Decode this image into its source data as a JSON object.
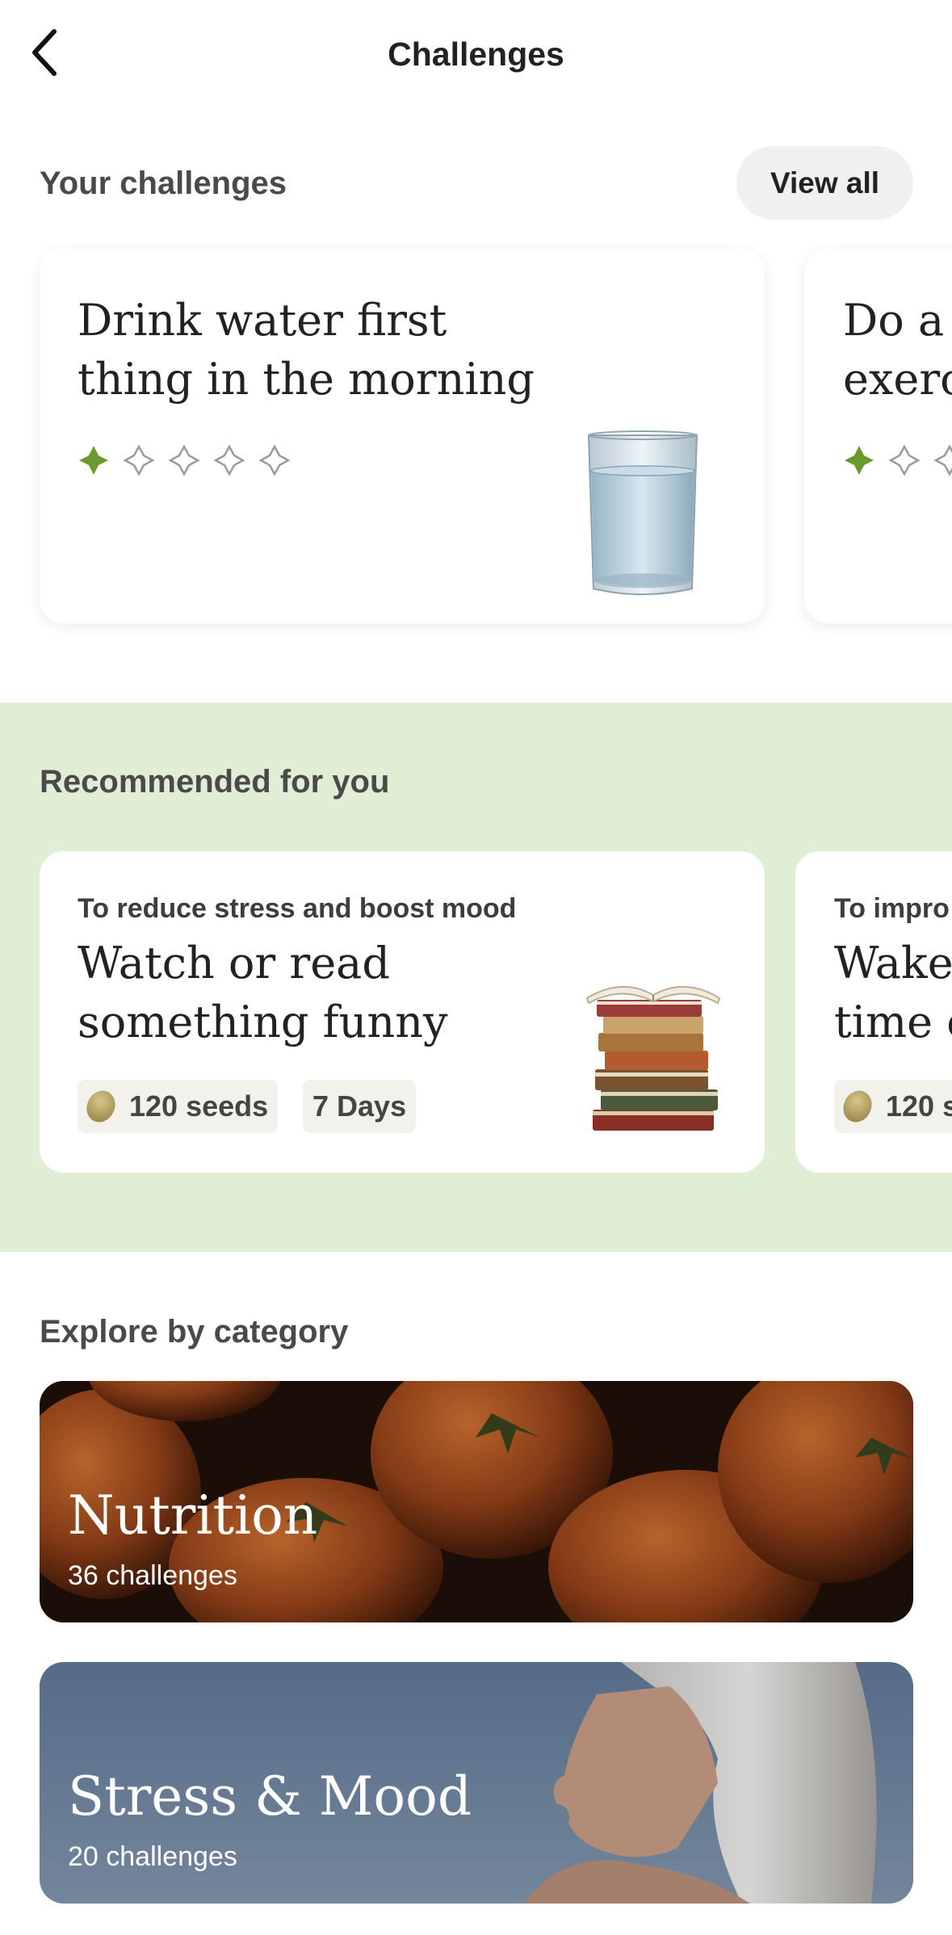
{
  "header": {
    "title": "Challenges"
  },
  "your_challenges": {
    "heading": "Your challenges",
    "view_all": "View all",
    "cards": [
      {
        "title_line1": "Drink water first",
        "title_line2": "thing in the morning",
        "progress_filled": 1,
        "progress_total": 5
      },
      {
        "title_line1": "Do a l",
        "title_line2": "exerc",
        "progress_filled": 1,
        "progress_total": 5
      }
    ]
  },
  "recommended": {
    "heading": "Recommended for you",
    "cards": [
      {
        "subtitle": "To reduce stress and boost mood",
        "title_line1": "Watch or read",
        "title_line2": "something funny",
        "seeds": "120 seeds",
        "duration": "7 Days"
      },
      {
        "subtitle": "To impro",
        "title_line1": "Wake",
        "title_line2": "time e",
        "seeds": "120 s"
      }
    ]
  },
  "categories": {
    "heading": "Explore by category",
    "items": [
      {
        "name": "Nutrition",
        "count": "36 challenges"
      },
      {
        "name": "Stress & Mood",
        "count": "20 challenges"
      }
    ]
  },
  "colors": {
    "accent_green": "#6a9a2e",
    "reco_band": "#e1eed6"
  }
}
